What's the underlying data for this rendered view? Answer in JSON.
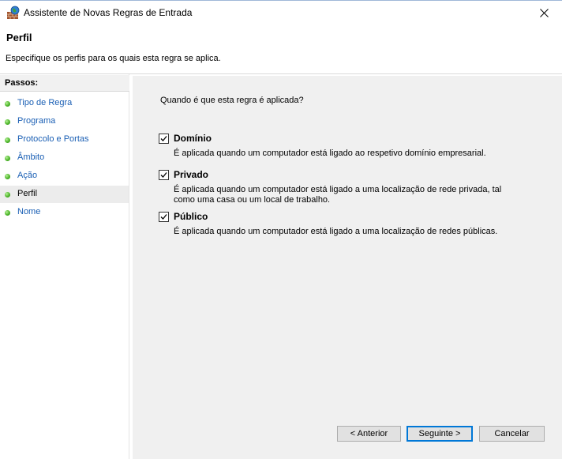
{
  "window": {
    "title": "Assistente de Novas Regras de Entrada"
  },
  "header": {
    "title": "Perfil",
    "description": "Especifique os perfis para os quais esta regra se aplica."
  },
  "steps": {
    "heading": "Passos:",
    "items": [
      {
        "label": "Tipo de Regra",
        "active": false
      },
      {
        "label": "Programa",
        "active": false
      },
      {
        "label": "Protocolo e Portas",
        "active": false
      },
      {
        "label": "Âmbito",
        "active": false
      },
      {
        "label": "Ação",
        "active": false
      },
      {
        "label": "Perfil",
        "active": true
      },
      {
        "label": "Nome",
        "active": false
      }
    ]
  },
  "main": {
    "question": "Quando é que esta regra é aplicada?",
    "options": [
      {
        "label": "Domínio",
        "checked": true,
        "description": "É aplicada quando um computador está ligado ao respetivo domínio empresarial."
      },
      {
        "label": "Privado",
        "checked": true,
        "description": "É aplicada quando um computador está ligado a uma localização de rede privada, tal como uma casa ou um local de trabalho."
      },
      {
        "label": "Público",
        "checked": true,
        "description": "É aplicada quando um computador está ligado a uma localização de redes públicas."
      }
    ]
  },
  "buttons": {
    "back": "< Anterior",
    "next": "Seguinte >",
    "cancel": "Cancelar"
  }
}
